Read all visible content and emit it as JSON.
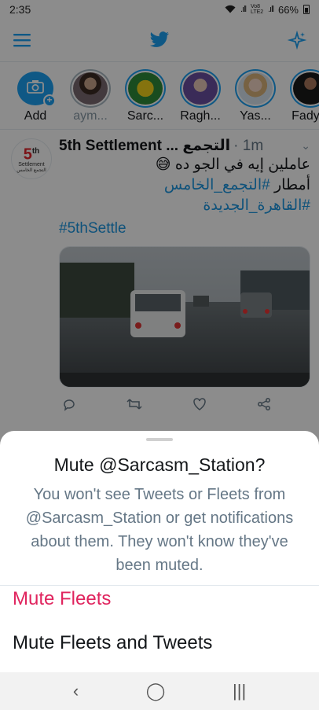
{
  "status_bar": {
    "time": "2:35",
    "signal1": ".ıll",
    "network_label": "Vo8 LTE2",
    "signal2": ".ıll",
    "battery": "66%"
  },
  "fleets": [
    {
      "label": "Add"
    },
    {
      "label": "aym..."
    },
    {
      "label": "Sarc..."
    },
    {
      "label": "Ragh..."
    },
    {
      "label": "Yas..."
    },
    {
      "label": "Fady..."
    }
  ],
  "tweet": {
    "avatar_logo_big": "5",
    "avatar_logo_sup": "th",
    "avatar_logo_word": "Settlement",
    "avatar_logo_small": "التجمع الخامس",
    "name": "5th Settlement ... التجمع",
    "time": "· 1m",
    "line1": "عاملين إيه في الجو ده 😅",
    "line2_text": "أمطار ",
    "line2_hash": "#التجمع_الخامس",
    "line3_hash": "#القاهرة_الجديدة",
    "line4_hash": "#5thSettle"
  },
  "sheet": {
    "title": "Mute @Sarcasm_Station?",
    "description": "You won't see Tweets or Fleets from @Sarcasm_Station or get notifications about them. They won't know they've been muted.",
    "option_mute_fleets": "Mute Fleets",
    "option_mute_all": "Mute Fleets and Tweets"
  },
  "navbar": {
    "back": "‹",
    "home": "◯",
    "recents": "|||"
  },
  "colors": {
    "accent": "#1da1f2",
    "destructive": "#e0245e",
    "secondary_text": "#657786"
  }
}
